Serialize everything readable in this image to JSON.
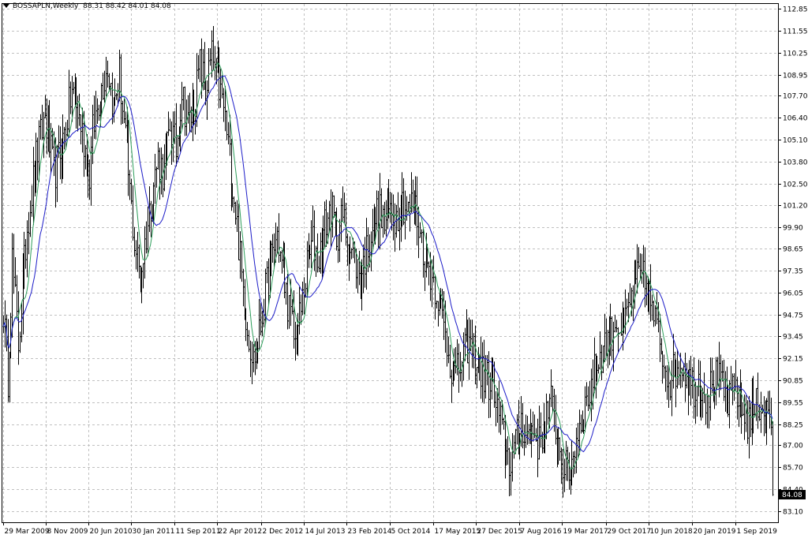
{
  "header": {
    "symbol_tf": "BOSSAPLN,Weekly",
    "ohlc": "88.31 88.42 84.01 84.08"
  },
  "colors": {
    "background": "#ffffff",
    "grid": "#c0c0c0",
    "bars": "#000000",
    "ma_fast": "#2e9e5b",
    "ma_slow": "#1c1cc8",
    "price_tag_bg": "#000000",
    "price_tag_fg": "#ffffff"
  },
  "chart_data": {
    "type": "ohlc",
    "title": "BOSSAPLN,Weekly",
    "grid": true,
    "y_axis": {
      "side": "right",
      "ticks": [
        "112.85",
        "111.55",
        "110.25",
        "108.95",
        "107.70",
        "106.40",
        "105.10",
        "103.80",
        "102.50",
        "101.20",
        "99.90",
        "98.65",
        "97.35",
        "96.05",
        "94.75",
        "93.45",
        "92.15",
        "90.85",
        "89.55",
        "88.25",
        "87.00",
        "85.70",
        "84.40",
        "83.10"
      ],
      "ylim": [
        83.1,
        112.85
      ]
    },
    "x_axis": {
      "ticks": [
        "29 Mar 2009",
        "8 Nov 2009",
        "20 Jun 2010",
        "30 Jan 2011",
        "11 Sep 2011",
        "22 Apr 2012",
        "2 Dec 2012",
        "14 Jul 2013",
        "23 Feb 2014",
        "5 Oct 2014",
        "17 May 2015",
        "27 Dec 2015",
        "7 Aug 2016",
        "19 Mar 2017",
        "29 Oct 2017",
        "10 Jun 2018",
        "20 Jan 2019",
        "1 Sep 2019"
      ]
    },
    "last_price": "84.08",
    "close_path": [
      [
        0,
        95.0
      ],
      [
        3,
        91.0
      ],
      [
        6,
        98.0
      ],
      [
        10,
        93.0
      ],
      [
        16,
        100.0
      ],
      [
        22,
        104.0
      ],
      [
        28,
        106.5
      ],
      [
        34,
        103.0
      ],
      [
        40,
        105.0
      ],
      [
        46,
        108.0
      ],
      [
        52,
        106.0
      ],
      [
        58,
        103.0
      ],
      [
        60,
        105.5
      ],
      [
        64,
        107.5
      ],
      [
        70,
        109.5
      ],
      [
        74,
        107.0
      ],
      [
        78,
        109.0
      ],
      [
        84,
        103.0
      ],
      [
        88,
        99.0
      ],
      [
        92,
        97.0
      ],
      [
        96,
        99.5
      ],
      [
        100,
        102.0
      ],
      [
        104,
        104.0
      ],
      [
        108,
        103.0
      ],
      [
        112,
        106.0
      ],
      [
        116,
        104.5
      ],
      [
        120,
        108.0
      ],
      [
        124,
        106.0
      ],
      [
        128,
        107.0
      ],
      [
        132,
        109.5
      ],
      [
        136,
        108.0
      ],
      [
        140,
        110.0
      ],
      [
        144,
        108.5
      ],
      [
        148,
        107.0
      ],
      [
        152,
        104.0
      ],
      [
        156,
        101.0
      ],
      [
        160,
        97.0
      ],
      [
        164,
        94.0
      ],
      [
        168,
        92.0
      ],
      [
        172,
        93.5
      ],
      [
        176,
        96.0
      ],
      [
        180,
        98.0
      ],
      [
        184,
        99.5
      ],
      [
        188,
        97.0
      ],
      [
        192,
        95.0
      ],
      [
        196,
        93.0
      ],
      [
        200,
        95.0
      ],
      [
        204,
        97.5
      ],
      [
        208,
        99.0
      ],
      [
        212,
        98.0
      ],
      [
        216,
        100.0
      ],
      [
        220,
        101.0
      ],
      [
        224,
        99.5
      ],
      [
        228,
        100.5
      ],
      [
        232,
        99.0
      ],
      [
        236,
        98.0
      ],
      [
        240,
        97.0
      ],
      [
        244,
        98.5
      ],
      [
        248,
        100.0
      ],
      [
        252,
        101.0
      ],
      [
        256,
        100.0
      ],
      [
        260,
        101.0
      ],
      [
        264,
        100.5
      ],
      [
        268,
        101.5
      ],
      [
        272,
        100.8
      ],
      [
        276,
        101.5
      ],
      [
        280,
        99.5
      ],
      [
        284,
        98.0
      ],
      [
        288,
        97.0
      ],
      [
        292,
        96.0
      ],
      [
        296,
        94.0
      ],
      [
        300,
        92.0
      ],
      [
        304,
        91.0
      ],
      [
        308,
        92.0
      ],
      [
        312,
        93.0
      ],
      [
        316,
        92.5
      ],
      [
        320,
        91.5
      ],
      [
        324,
        91.0
      ],
      [
        328,
        90.5
      ],
      [
        332,
        89.0
      ],
      [
        336,
        87.5
      ],
      [
        340,
        86.0
      ],
      [
        344,
        87.0
      ],
      [
        348,
        88.5
      ],
      [
        352,
        87.5
      ],
      [
        356,
        88.0
      ],
      [
        360,
        87.0
      ],
      [
        364,
        88.5
      ],
      [
        368,
        89.5
      ],
      [
        372,
        87.5
      ],
      [
        376,
        86.0
      ],
      [
        380,
        85.0
      ],
      [
        384,
        87.0
      ],
      [
        388,
        88.5
      ],
      [
        392,
        89.5
      ],
      [
        396,
        91.0
      ],
      [
        400,
        92.0
      ],
      [
        404,
        93.0
      ],
      [
        408,
        93.5
      ],
      [
        412,
        94.5
      ],
      [
        416,
        93.5
      ],
      [
        420,
        95.0
      ],
      [
        424,
        96.5
      ],
      [
        428,
        97.0
      ],
      [
        432,
        96.5
      ],
      [
        436,
        95.0
      ],
      [
        440,
        93.5
      ],
      [
        444,
        92.0
      ],
      [
        448,
        91.0
      ],
      [
        452,
        91.5
      ],
      [
        456,
        92.0
      ],
      [
        460,
        91.0
      ],
      [
        464,
        90.5
      ],
      [
        468,
        91.0
      ],
      [
        472,
        90.0
      ],
      [
        476,
        90.5
      ],
      [
        480,
        91.0
      ],
      [
        484,
        90.0
      ],
      [
        488,
        89.5
      ],
      [
        492,
        90.5
      ],
      [
        496,
        89.0
      ],
      [
        500,
        88.5
      ],
      [
        504,
        89.0
      ],
      [
        508,
        89.5
      ],
      [
        512,
        89.0
      ],
      [
        516,
        88.5
      ],
      [
        517,
        84.08
      ]
    ],
    "series": [
      {
        "type": "ohlc",
        "bar_count": 518
      },
      {
        "type": "ma"
      },
      {
        "type": "ma"
      }
    ]
  }
}
